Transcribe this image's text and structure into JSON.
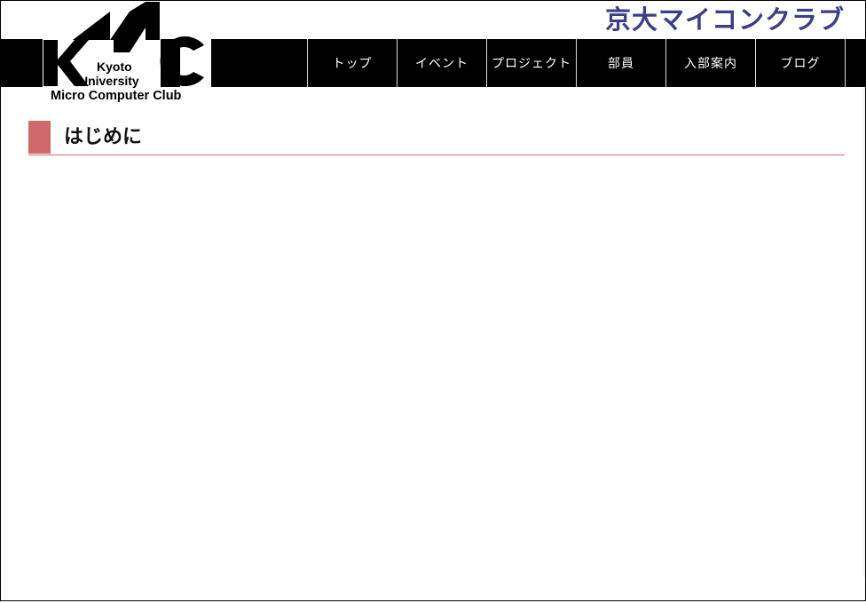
{
  "header": {
    "site_title": "京大マイコンクラブ",
    "logo": {
      "mark": "KMC",
      "line1": "Kyoto",
      "line2": "University",
      "line3": "Micro Computer Club"
    }
  },
  "nav": {
    "items": [
      {
        "label": "トップ"
      },
      {
        "label": "イベント"
      },
      {
        "label": "プロジェクト"
      },
      {
        "label": "部員"
      },
      {
        "label": "入部案内"
      },
      {
        "label": "ブログ"
      }
    ]
  },
  "main": {
    "heading": "はじめに",
    "accent_color": "#d06a6a",
    "title_color": "#3b3f86"
  }
}
